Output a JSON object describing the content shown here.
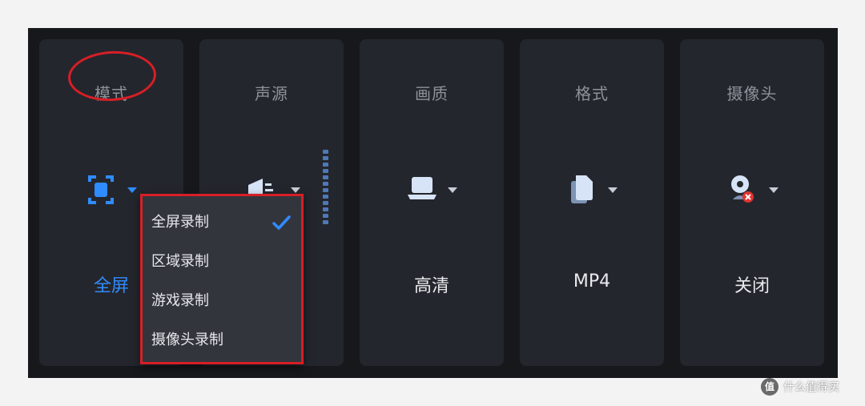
{
  "colors": {
    "panel_bg": "#17181c",
    "card_bg": "#24262d",
    "accent_blue": "#2f8cff",
    "highlight_red": "#d81e26",
    "menu_bg": "#33353d"
  },
  "cards": {
    "mode": {
      "title": "模式",
      "value": "全屏",
      "icon": "fullscreen-icon"
    },
    "audio": {
      "title": "声源",
      "icon": "speaker-icon",
      "level_meter_segments": 12
    },
    "quality": {
      "title": "画质",
      "value": "高清",
      "icon": "laptop-icon"
    },
    "format": {
      "title": "格式",
      "value": "MP4",
      "icon": "file-icon"
    },
    "camera": {
      "title": "摄像头",
      "value": "关闭",
      "icon": "webcam-off-icon"
    }
  },
  "mode_menu": {
    "selected": "全屏录制",
    "items": [
      {
        "label": "全屏录制",
        "checked": true
      },
      {
        "label": "区域录制",
        "checked": false
      },
      {
        "label": "游戏录制",
        "checked": false
      },
      {
        "label": "摄像头录制",
        "checked": false
      }
    ]
  },
  "watermark": {
    "badge": "值",
    "text": "什么值得买"
  }
}
